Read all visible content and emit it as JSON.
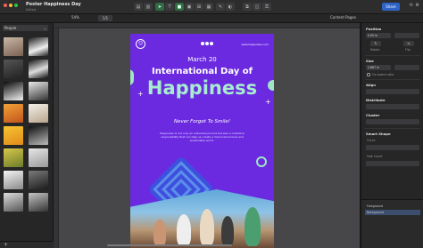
{
  "window": {
    "title": "Poster Happiness Day",
    "subtitle": "Edited"
  },
  "toolbar": {
    "zoom": "54%",
    "page": "1/1",
    "share_label": "Share"
  },
  "secondary_bar": {
    "content_pages": "Content Pages"
  },
  "sidebar": {
    "section": "People"
  },
  "poster": {
    "site": "www.happiness.com",
    "date": "March 20",
    "headline": "International Day of",
    "headline_big": "Happiness",
    "tagline": "Never Forget To Smile!",
    "body": "Happiness is not only an individual pursuit but also a collective responsibility that can help us create a more harmonious and sustainable world."
  },
  "inspector": {
    "position": "Position",
    "rotate": "Rotate",
    "flip": "Flip",
    "size": "Size",
    "fix_aspect": "Fix aspect ratio",
    "align": "Align",
    "distribute": "Distribute",
    "cluster": "Cluster",
    "smart_shape": "Smart Shape",
    "curve": "Curve",
    "side_count": "Side Count",
    "x_value": "0.00 in",
    "w_value": "2.867 in",
    "layers": [
      "Foreground",
      "Background"
    ]
  },
  "colors": {
    "poster_purple": "#6b2ae0",
    "mint": "#a8ecd0",
    "accent_blue": "#2e64c7"
  }
}
